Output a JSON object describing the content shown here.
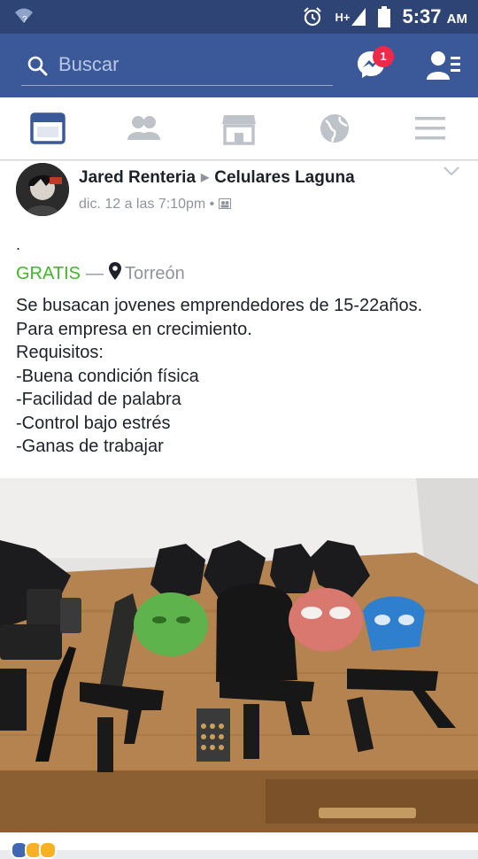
{
  "status": {
    "time": "5:37",
    "ampm": "AM",
    "network": "H+"
  },
  "search": {
    "placeholder": "Buscar"
  },
  "messenger": {
    "badge": "1"
  },
  "post": {
    "author": "Jared Renteria",
    "group": "Celulares Laguna",
    "timestamp": "dic. 12 a las 7:10pm",
    "separator": "•",
    "dot_line": ".",
    "price": "GRATIS",
    "dash": "—",
    "location": "Torreón",
    "lines": [
      "Se busacan jovenes emprendedores de 15-22años.",
      "Para empresa en crecimiento.",
      "Requisitos:",
      "-Buena condición física",
      "-Facilidad de palabra",
      "-Control bajo estrés",
      "-Ganas de trabajar"
    ]
  },
  "colors": {
    "header_blue": "#3b5998",
    "status_blue": "#2d4474",
    "gratis_green": "#42b72a",
    "badge_red": "#f02849",
    "meta_gray": "#90949c"
  },
  "icons": [
    "wifi-icon",
    "alarm-icon",
    "battery-icon",
    "search-icon",
    "messenger-icon",
    "friend-requests-icon",
    "news-feed-icon",
    "groups-icon",
    "marketplace-icon",
    "notifications-globe-icon",
    "menu-icon",
    "location-pin-icon",
    "audience-icon",
    "chevron-down-icon"
  ]
}
